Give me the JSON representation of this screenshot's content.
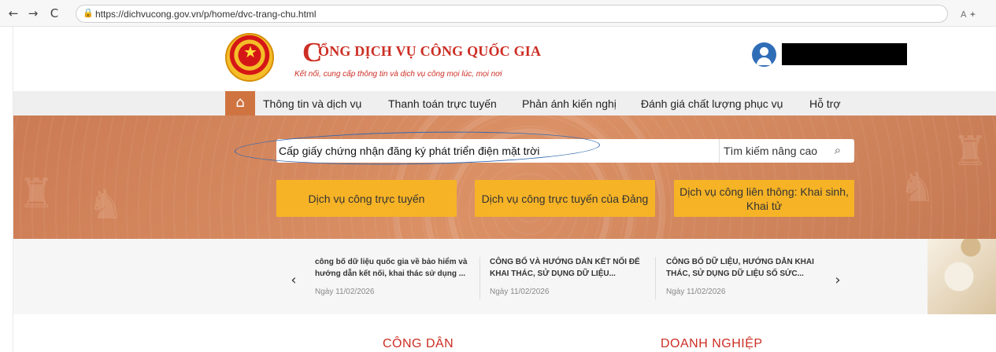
{
  "browser": {
    "back_icon": "←",
    "forward_icon": "→",
    "refresh_icon": "C",
    "url": "https://dichvucong.gov.vn/p/home/dvc-trang-chu.html",
    "lock_icon": "lock-icon",
    "extra_actions": "A 🟅"
  },
  "site": {
    "brand_letter": "C",
    "title": "ỔNG DỊCH VỤ CÔNG QUỐC GIA",
    "subtitle": "Kết nối, cung cấp thông tin và dịch vụ công mọi lúc, mọi nơi"
  },
  "menu": {
    "home_icon": "house-icon",
    "items": [
      "Thông tin và dịch vụ",
      "Thanh toán trực tuyến",
      "Phản ánh kiến nghị",
      "Đánh giá chất lượng phục vụ",
      "Hỗ trợ"
    ]
  },
  "search": {
    "value": "Cấp giấy chứng nhận đăng ký phát triển điện mặt trời",
    "advanced": "Tìm kiếm nâng cao",
    "button_icon": "search-icon"
  },
  "services": [
    "Dịch vụ công trực tuyến",
    "Dịch vụ công trực tuyến của Đảng",
    "Dịch vụ công liên thông: Khai sinh, Khai tử"
  ],
  "news": {
    "items": [
      {
        "title": "công bố dữ liệu quốc gia về bảo hiểm và hướng dẫn kết nối, khai thác sử dụng ...",
        "date": "Ngày 11/02/2026"
      },
      {
        "title": "CÔNG BỐ VÀ HƯỚNG DẪN KẾT NỐI ĐỂ KHAI THÁC, SỬ DỤNG DỮ LIỆU...",
        "date": "Ngày 11/02/2026"
      },
      {
        "title": "CÔNG BỐ DỮ LIỆU, HƯỚNG DẪN KHAI THÁC, SỬ DỤNG DỮ LIỆU SỐ SỨC...",
        "date": "Ngày 11/02/2026"
      }
    ],
    "prev_icon": "‹",
    "next_icon": "›"
  },
  "sections": [
    "CÔNG DÂN",
    "DOANH NGHIỆP"
  ],
  "colors": {
    "brand": "#cc2e24",
    "banner": "#d98c61",
    "service_button": "#f6b326",
    "home_button": "#cf7441",
    "account": "#2f6eb7",
    "highlight": "#3569ad"
  }
}
